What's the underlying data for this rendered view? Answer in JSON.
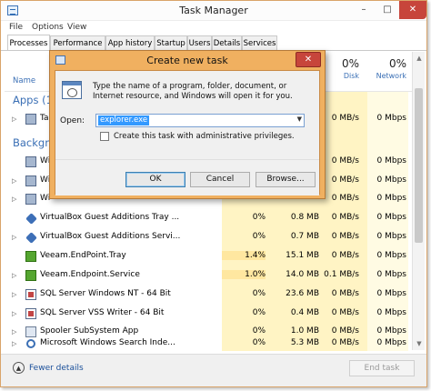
{
  "window": {
    "title": "Task Manager",
    "minimize": "–",
    "maximize": "□",
    "close": "✕"
  },
  "menu": [
    "File",
    "Options",
    "View"
  ],
  "tabs": [
    "Processes",
    "Performance",
    "App history",
    "Startup",
    "Users",
    "Details",
    "Services"
  ],
  "columns": {
    "name": "Name",
    "disk": {
      "percent": "0%",
      "label": "Disk"
    },
    "network": {
      "percent": "0%",
      "label": "Network"
    }
  },
  "sections": {
    "apps": "Apps (1",
    "background": "Backgro"
  },
  "rows": [
    {
      "name": "Ta",
      "cpu": "",
      "mem": "",
      "disk": "0 MB/s",
      "net": "0 Mbps",
      "expandable": true,
      "icon": "task-manager-icon"
    },
    {
      "name": "Wi",
      "cpu": "",
      "mem": "",
      "disk": "0 MB/s",
      "net": "0 Mbps",
      "expandable": false,
      "icon": "system-process-icon"
    },
    {
      "name": "Wi",
      "cpu": "",
      "mem": "",
      "disk": "0 MB/s",
      "net": "0 Mbps",
      "expandable": true,
      "icon": "system-process-icon"
    },
    {
      "name": "Wi",
      "cpu": "",
      "mem": "",
      "disk": "0 MB/s",
      "net": "0 Mbps",
      "expandable": true,
      "icon": "system-process-icon"
    },
    {
      "name": "VirtualBox Guest Additions Tray ...",
      "cpu": "0%",
      "mem": "0.8 MB",
      "disk": "0 MB/s",
      "net": "0 Mbps",
      "expandable": false,
      "icon": "virtualbox-icon"
    },
    {
      "name": "VirtualBox Guest Additions Servi...",
      "cpu": "0%",
      "mem": "0.7 MB",
      "disk": "0 MB/s",
      "net": "0 Mbps",
      "expandable": true,
      "icon": "virtualbox-icon"
    },
    {
      "name": "Veeam.EndPoint.Tray",
      "cpu": "1.4%",
      "mem": "15.1 MB",
      "disk": "0 MB/s",
      "net": "0 Mbps",
      "expandable": false,
      "icon": "veeam-icon"
    },
    {
      "name": "Veeam.Endpoint.Service",
      "cpu": "1.0%",
      "mem": "14.0 MB",
      "disk": "0.1 MB/s",
      "net": "0 Mbps",
      "expandable": true,
      "icon": "veeam-icon"
    },
    {
      "name": "SQL Server Windows NT - 64 Bit",
      "cpu": "0%",
      "mem": "23.6 MB",
      "disk": "0 MB/s",
      "net": "0 Mbps",
      "expandable": true,
      "icon": "sql-server-icon"
    },
    {
      "name": "SQL Server VSS Writer - 64 Bit",
      "cpu": "0%",
      "mem": "0.4 MB",
      "disk": "0 MB/s",
      "net": "0 Mbps",
      "expandable": true,
      "icon": "sql-server-icon"
    },
    {
      "name": "Spooler SubSystem App",
      "cpu": "0%",
      "mem": "1.0 MB",
      "disk": "0 MB/s",
      "net": "0 Mbps",
      "expandable": true,
      "icon": "spooler-icon"
    },
    {
      "name": "Microsoft Windows Search Inde...",
      "cpu": "0%",
      "mem": "5.3 MB",
      "disk": "0 MB/s",
      "net": "0 Mbps",
      "expandable": true,
      "icon": "search-indexer-icon"
    }
  ],
  "footer": {
    "fewer_details": "Fewer details",
    "end_task": "End task"
  },
  "dialog": {
    "title": "Create new task",
    "close": "✕",
    "message": "Type the name of a program, folder, document, or Internet resource, and Windows will open it for you.",
    "open_label": "Open:",
    "open_value": "explorer.exe",
    "admin_label": "Create this task with administrative privileges.",
    "admin_checked": false,
    "ok": "OK",
    "cancel": "Cancel",
    "browse": "Browse..."
  }
}
